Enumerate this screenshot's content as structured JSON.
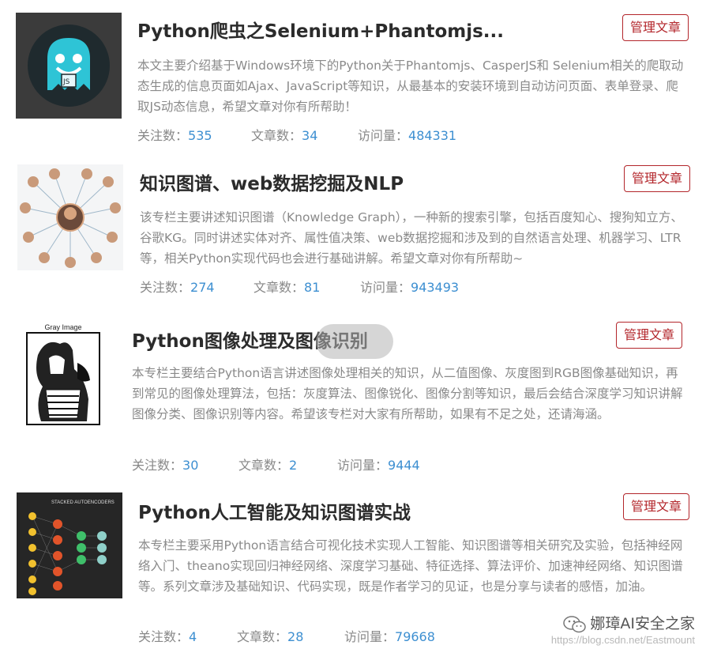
{
  "columns": [
    {
      "title": "Python爬虫之Selenium+Phantomjs...",
      "manage_label": "管理文章",
      "description": "本文主要介绍基于Windows环境下的Python关于Phantomjs、CasperJS和 Selenium相关的爬取动态生成的信息页面如Ajax、JavaScript等知识，从最基本的安装环境到自动访问页面、表单登录、爬取JS动态信息，希望文章对你有所帮助！",
      "follow_label": "关注数：",
      "follow_count": "535",
      "article_label": "文章数：",
      "article_count": "34",
      "visit_label": "访问量：",
      "visit_count": "484331",
      "thumb_icon": "phantomjs-ghost-logo"
    },
    {
      "title": "知识图谱、web数据挖掘及NLP",
      "manage_label": "管理文章",
      "description": "该专栏主要讲述知识图谱（Knowledge Graph），一种新的搜索引擎，包括百度知心、搜狗知立方、谷歌KG。同时讲述实体对齐、属性值决策、web数据挖掘和涉及到的自然语言处理、机器学习、LTR等，相关Python实现代码也会进行基础讲解。希望文章对你有所帮助~",
      "follow_label": "关注数：",
      "follow_count": "274",
      "article_label": "文章数：",
      "article_count": "81",
      "visit_label": "访问量：",
      "visit_count": "943493",
      "thumb_icon": "people-network-graph"
    },
    {
      "title": "Python图像处理及图像识别",
      "manage_label": "管理文章",
      "description": "本专栏主要结合Python语言讲述图像处理相关的知识，从二值图像、灰度图到RGB图像基础知识，再到常见的图像处理算法，包括：灰度算法、图像锐化、图像分割等知识，最后会结合深度学习知识讲解图像分类、图像识别等内容。希望该专栏对大家有所帮助，如果有不足之处，还请海涵。",
      "follow_label": "关注数：",
      "follow_count": "30",
      "article_label": "文章数：",
      "article_count": "2",
      "visit_label": "访问量：",
      "visit_count": "9444",
      "thumb_caption": "Gray Image",
      "thumb_icon": "gray-image-illustration"
    },
    {
      "title": "Python人工智能及知识图谱实战",
      "manage_label": "管理文章",
      "description": "本专栏主要采用Python语言结合可视化技术实现人工智能、知识图谱等相关研究及实验，包括神经网络入门、theano实现回归神经网络、深度学习基础、特征选择、算法评价、加速神经网络、知识图谱等。系列文章涉及基础知识、代码实现，既是作者学习的见证，也是分享与读者的感悟，加油。",
      "follow_label": "关注数：",
      "follow_count": "4",
      "article_label": "文章数：",
      "article_count": "28",
      "visit_label": "访问量：",
      "visit_count": "79668",
      "thumb_caption": "STACKED AUTOENCODERS",
      "thumb_icon": "neural-network-diagram"
    }
  ],
  "watermark": {
    "brand": "娜璋AI安全之家",
    "url": "https://blog.csdn.net/Eastmount"
  },
  "colors": {
    "accent": "#b3262b",
    "link": "#3d8fd1",
    "text_muted": "#8a8a8a"
  }
}
